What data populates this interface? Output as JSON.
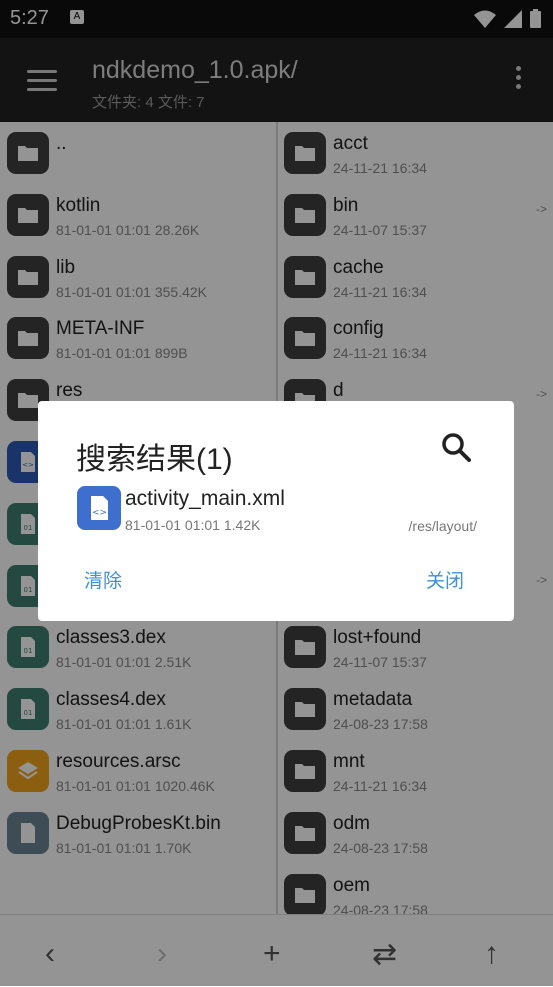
{
  "status": {
    "time": "5:27",
    "notif": "A"
  },
  "appbar": {
    "title": "ndkdemo_1.0.apk/",
    "subtitle": "文件夹: 4  文件: 7"
  },
  "left": [
    {
      "name": "..",
      "meta": "",
      "icon": "folder-icon",
      "color": "dark"
    },
    {
      "name": "kotlin",
      "meta": "81-01-01 01:01  28.26K",
      "icon": "folder-icon",
      "color": "dark"
    },
    {
      "name": "lib",
      "meta": "81-01-01 01:01  355.42K",
      "icon": "folder-icon",
      "color": "dark"
    },
    {
      "name": "META-INF",
      "meta": "81-01-01 01:01  899B",
      "icon": "folder-icon",
      "color": "dark"
    },
    {
      "name": "res",
      "meta": "",
      "icon": "folder-icon",
      "color": "dark"
    },
    {
      "name": "",
      "meta": "",
      "icon": "code-file-icon",
      "color": "blue"
    },
    {
      "name": "",
      "meta": "",
      "icon": "dex-file-icon",
      "color": "teal"
    },
    {
      "name": "",
      "meta": "",
      "icon": "dex-file-icon",
      "color": "teal"
    },
    {
      "name": "classes3.dex",
      "meta": "81-01-01 01:01  2.51K",
      "icon": "dex-file-icon",
      "color": "teal"
    },
    {
      "name": "classes4.dex",
      "meta": "81-01-01 01:01  1.61K",
      "icon": "dex-file-icon",
      "color": "teal"
    },
    {
      "name": "resources.arsc",
      "meta": "81-01-01 01:01  1020.46K",
      "icon": "layers-icon",
      "color": "orange"
    },
    {
      "name": "DebugProbesKt.bin",
      "meta": "81-01-01 01:01  1.70K",
      "icon": "file-icon",
      "color": "slate"
    }
  ],
  "right": [
    {
      "name": "acct",
      "meta": "24-11-21 16:34",
      "arrow": ""
    },
    {
      "name": "bin",
      "meta": "24-11-07 15:37",
      "arrow": "->"
    },
    {
      "name": "cache",
      "meta": "24-11-21 16:34",
      "arrow": ""
    },
    {
      "name": "config",
      "meta": "24-11-21 16:34",
      "arrow": ""
    },
    {
      "name": "d",
      "meta": "",
      "arrow": "->"
    },
    {
      "name": "",
      "meta": "",
      "arrow": ""
    },
    {
      "name": "",
      "meta": "",
      "arrow": ""
    },
    {
      "name": "",
      "meta": "",
      "arrow": "->"
    },
    {
      "name": "lost+found",
      "meta": "24-11-07 15:37",
      "arrow": ""
    },
    {
      "name": "metadata",
      "meta": "24-08-23 17:58",
      "arrow": ""
    },
    {
      "name": "mnt",
      "meta": "24-11-21 16:34",
      "arrow": ""
    },
    {
      "name": "odm",
      "meta": "24-08-23 17:58",
      "arrow": ""
    },
    {
      "name": "oem",
      "meta": "24-08-23 17:58",
      "arrow": ""
    }
  ],
  "bottombar": {
    "back": "‹",
    "forward": "›",
    "add": "+",
    "swap": "⇄",
    "up": "↑"
  },
  "dialog": {
    "title": "搜索结果(1)",
    "result_name": "activity_main.xml",
    "result_meta": "81-01-01 01:01  1.42K",
    "result_path": "/res/layout/",
    "clear_label": "清除",
    "close_label": "关闭"
  },
  "colors": {
    "accent": "#3f90d9",
    "appbar": "#212121",
    "folder": "#3e3e3e"
  }
}
